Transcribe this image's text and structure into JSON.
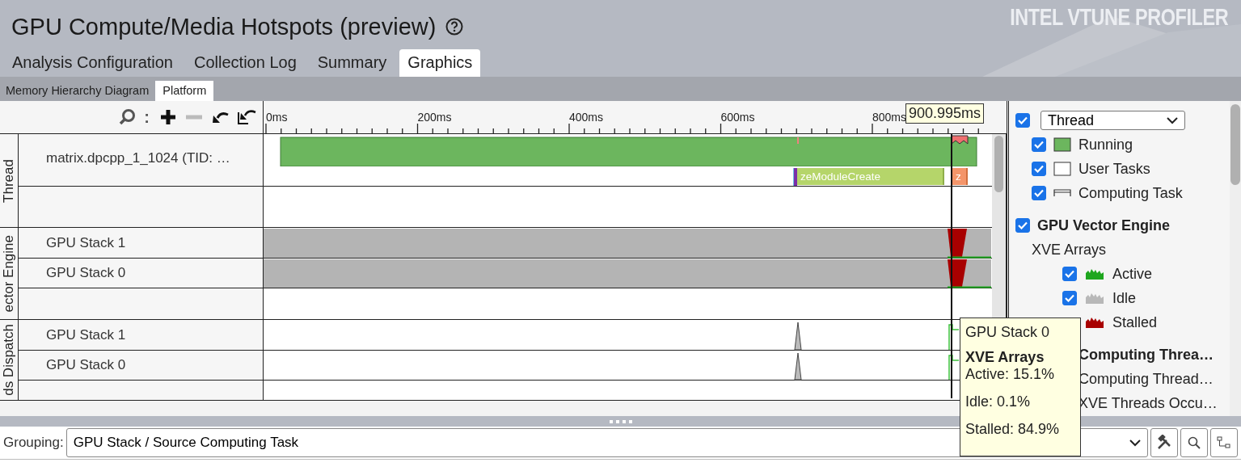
{
  "app": {
    "title": "GPU Compute/Media Hotspots (preview)",
    "logo": "INTEL VTUNE PROFILER"
  },
  "tabs": [
    {
      "label": "Analysis Configuration",
      "selected": false
    },
    {
      "label": "Collection Log",
      "selected": false
    },
    {
      "label": "Summary",
      "selected": false
    },
    {
      "label": "Graphics",
      "selected": true
    }
  ],
  "subtabs": [
    {
      "label": "Memory Hierarchy Diagram",
      "selected": false
    },
    {
      "label": "Platform",
      "selected": true
    }
  ],
  "toolbar": {
    "zoom_separator": ":",
    "tools": [
      {
        "kind": "zoom-in",
        "disabled": false
      },
      {
        "kind": "zoom-out",
        "disabled": true
      },
      {
        "kind": "undo",
        "disabled": false
      },
      {
        "kind": "reset",
        "disabled": false
      }
    ]
  },
  "ruler": {
    "ticks": [
      "0ms",
      "200ms",
      "400ms",
      "600ms",
      "800ms"
    ],
    "cursor": "900.995ms"
  },
  "groups": [
    {
      "label": "Thread",
      "rows": [
        {
          "kind": "thread",
          "name": "matrix.dpcpp_1_1024 (TID: …",
          "tasks": [
            "zeModuleCreate",
            "z"
          ]
        },
        {
          "kind": "blank"
        }
      ]
    },
    {
      "label": "ector Engine",
      "rows": [
        {
          "kind": "engine",
          "name": "GPU Stack 1"
        },
        {
          "kind": "engine",
          "name": "GPU Stack 0"
        },
        {
          "kind": "blank"
        }
      ]
    },
    {
      "label": "ds Dispatch",
      "rows": [
        {
          "kind": "dispatch",
          "name": "GPU Stack 1"
        },
        {
          "kind": "dispatch",
          "name": "GPU Stack 0"
        },
        {
          "kind": "blank"
        }
      ]
    }
  ],
  "legend": {
    "select": {
      "value": "Thread",
      "checked": true
    },
    "thread_items": [
      {
        "kind": "running",
        "label": "Running",
        "checked": true
      },
      {
        "kind": "user",
        "label": "User Tasks",
        "checked": true
      },
      {
        "kind": "computing",
        "label": "Computing Task",
        "checked": true
      }
    ],
    "engine": {
      "label": "GPU Vector Engine",
      "checked": true,
      "subheading": "XVE Arrays",
      "items": [
        {
          "label": "Active",
          "checked": true,
          "color": "#1ea61e"
        },
        {
          "label": "Idle",
          "checked": true,
          "color": "#b8b8b8"
        },
        {
          "label": "Stalled",
          "color": "#a80000"
        }
      ]
    },
    "more": {
      "label": "Computing Threa…",
      "items": [
        "Computing Thread…",
        "XVE Threads Occu…"
      ]
    }
  },
  "tooltip": {
    "title": "GPU Stack 0",
    "heading": "XVE Arrays",
    "lines": [
      "Active: 15.1%",
      "Idle: 0.1%",
      "Stalled: 84.9%"
    ]
  },
  "grouping": {
    "label": "Grouping:",
    "value": "GPU Stack / Source Computing Task"
  }
}
